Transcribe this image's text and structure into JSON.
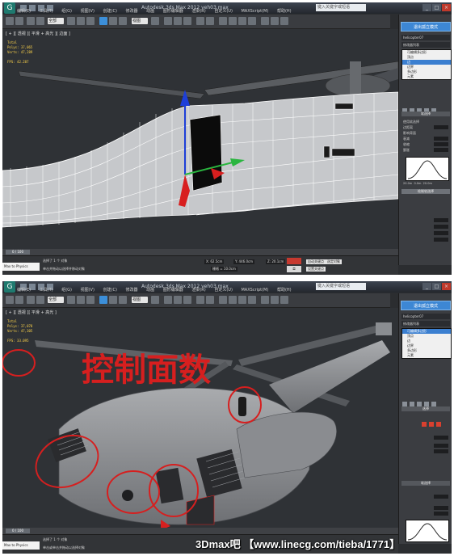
{
  "app": {
    "title_top": "Autodesk 3ds Max 2012      veh03.max",
    "title_bottom": "Autodesk 3ds Max 2012      veh03.max",
    "search_placeholder": "键入关键字或短语",
    "menu": [
      "编辑(E)",
      "工具(T)",
      "组(G)",
      "视图(V)",
      "创建(C)",
      "修改器",
      "动画",
      "图形编辑器",
      "渲染(R)",
      "自定义(U)",
      "MAXScript(M)",
      "帮助(H)"
    ],
    "selection_filter": "全部",
    "view_mode": "视图"
  },
  "viewport_top": {
    "label": "[ + ][ 透视 ][ 平滑 + 高光 ][ 边面 ]",
    "stats": [
      "Total",
      "Polys: 37,065",
      "Verts: 47,289",
      "",
      "FPS: 42.287"
    ]
  },
  "viewport_bottom": {
    "label": "[ + ][ 透视 ][ 平滑 + 高光 ]",
    "stats": [
      "Total",
      "Polys: 37,078",
      "Verts: 47,305",
      "",
      "FPS: 33.095"
    ],
    "annotation": "控制面数"
  },
  "command_panel_top": {
    "dropdown": "多边形建模",
    "button": "退出孤立模式",
    "object_name": "helicopter07",
    "modifier_list_label": "修改器列表",
    "stack": [
      "可编辑多边形",
      "顶点",
      "边",
      "边界",
      "多边形",
      "元素"
    ],
    "stack_selected": "边",
    "rollout_soft": "软选择",
    "soft_fields": [
      "使用软选择",
      "边距离",
      "影响背面",
      "衰减",
      "收缩",
      "膨胀"
    ],
    "soft_values": [
      "",
      "1",
      "",
      "20.0",
      "0.0",
      "0.0"
    ],
    "curve_labels": [
      "20.0m",
      "0.0m",
      "20.0m"
    ],
    "paint_label": "绘制软选择"
  },
  "command_panel_bottom": {
    "dropdown": "多边形建模",
    "button": "退出孤立模式",
    "object_name": "helicopter07",
    "modifier_list_label": "修改器列表",
    "stack": [
      "可编辑多边形",
      "顶点",
      "边",
      "边界",
      "多边形",
      "元素"
    ],
    "stack_selected": "可编辑多边形",
    "rollout_sel": "选择",
    "rollout_soft": "软选择",
    "curve_labels": [
      "20.0m",
      "0.0m",
      "20.0m"
    ]
  },
  "status_top": {
    "maxscript": "Max to Physics",
    "line1": "选择了 1 个 对象",
    "line2": "单击并拖动以选择并移动对象",
    "frame": "0 / 100",
    "x": "X: 62.5cm",
    "y": "Y: 446.0cm",
    "z": "Z: 20.1cm",
    "grid": "栅格 = 10.0cm",
    "autokey": "自动关键点",
    "set_key": "设置关键点",
    "key_filter": "选定对象"
  },
  "status_bottom": {
    "maxscript": "Max to Physics",
    "line1": "选择了 1 个 对象",
    "line2": "单击或单击并拖动以选择对象",
    "frame": "0 / 100"
  },
  "watermark": "3Dmax吧 【www.linecg.com/tieba/1771】",
  "colors": {
    "viewport": "#2f3236",
    "annotation_red": "#d61f1f",
    "gizmo_blue": "#1d3fd8",
    "gizmo_green": "#2ab53f",
    "gizmo_red": "#d81f1f",
    "stats_yellow": "#ffd54a",
    "selection_blue": "#3b7fd0"
  }
}
